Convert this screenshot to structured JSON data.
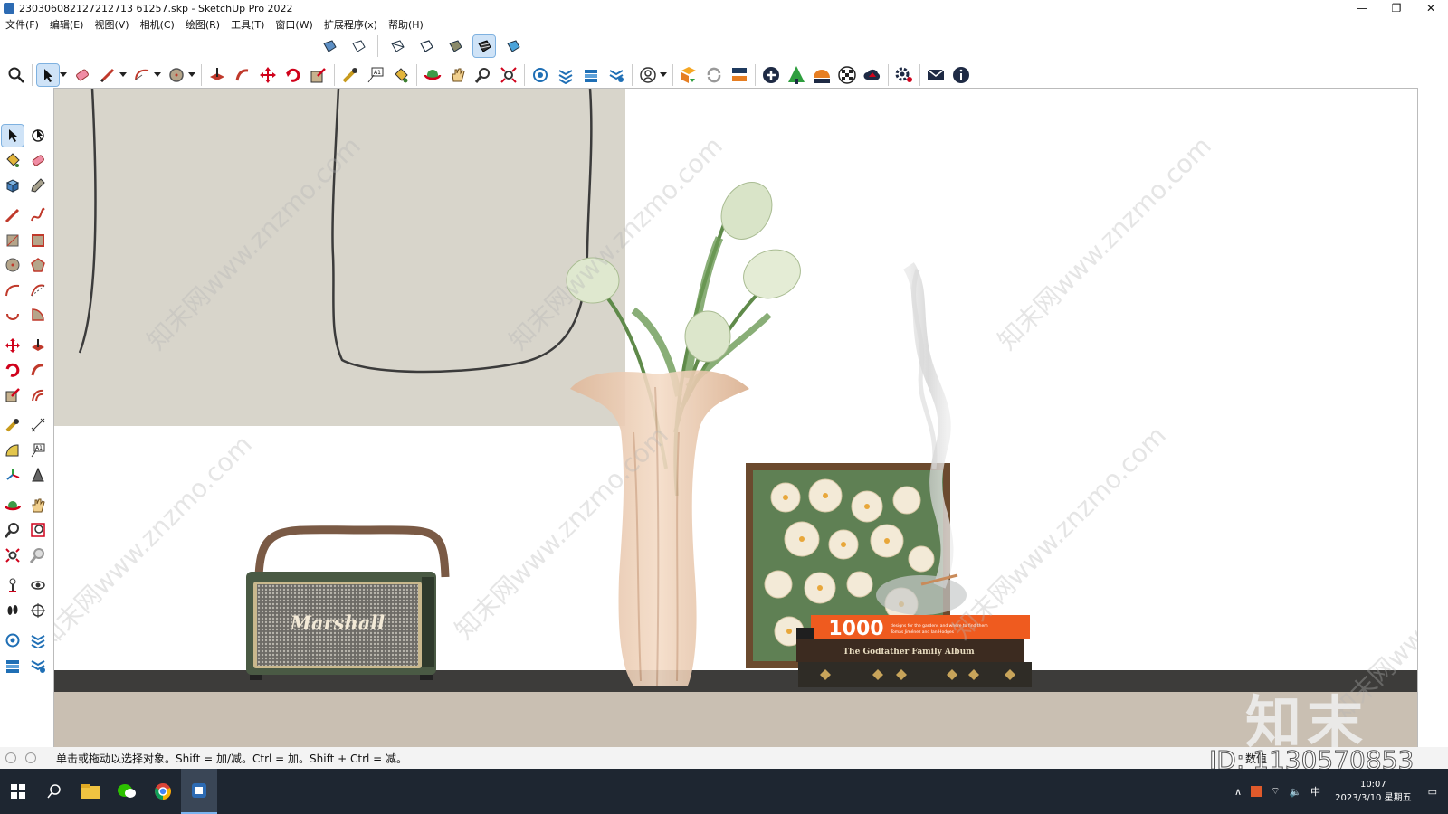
{
  "window": {
    "title": "230306082127212713 61257.skp - SketchUp Pro 2022",
    "min": "—",
    "restore": "❐",
    "close": "✕"
  },
  "menu": [
    "文件(F)",
    "编辑(E)",
    "视图(V)",
    "相机(C)",
    "绘图(R)",
    "工具(T)",
    "窗口(W)",
    "扩展程序(x)",
    "帮助(H)"
  ],
  "viewport": {
    "radio_brand": "Marshall",
    "book_top_number": "1000",
    "book_top_subtitle": "designs for the gardens and where to find them",
    "book_top_authors": "Tomás Jiménez and Ian Hodges",
    "book_middle_title": "The Godfather Family Album",
    "watermark": "知末网www.znzmo.com"
  },
  "status": {
    "hint": "单击或拖动以选择对象。Shift = 加/减。Ctrl = 加。Shift + Ctrl = 减。",
    "measure_label": "数值"
  },
  "overlay": {
    "brand": "知末",
    "id_text": "ID: 1130570853"
  },
  "taskbar": {
    "clock_time": "10:07",
    "clock_date": "2023/3/10 星期五",
    "ime": "中"
  },
  "colors": {
    "accent": "#2d6bb3",
    "wall": "#d8d5cb",
    "shelf": "#3d3c3a",
    "floor": "#c9bfb2",
    "vase": "#e7c6ad",
    "radio_green": "#4a5a44",
    "book_orange": "#ef5b1f"
  }
}
